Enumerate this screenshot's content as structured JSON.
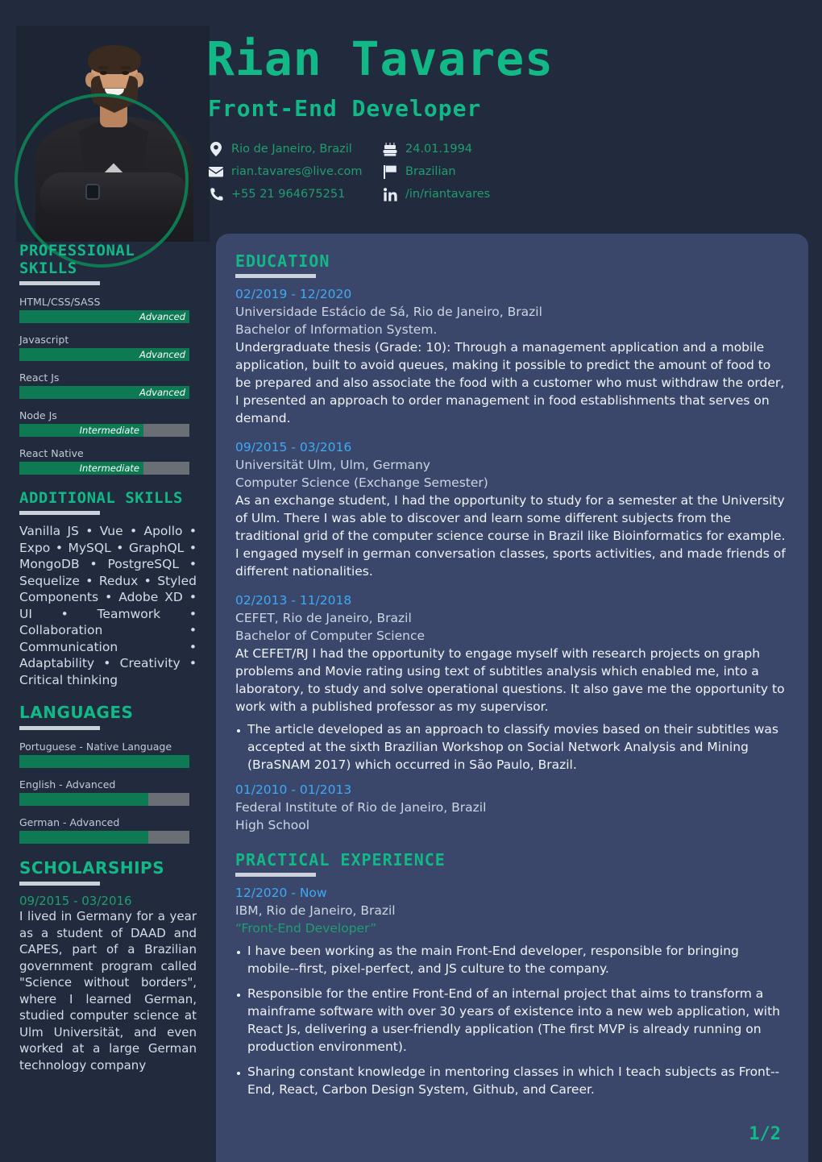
{
  "header": {
    "name": "Rian Tavares",
    "role": "Front-End Developer",
    "contacts": [
      {
        "icon": "location-pin-icon",
        "text": "Rio de Janeiro,  Brazil"
      },
      {
        "icon": "birthday-cake-icon",
        "text": "24.01.1994"
      },
      {
        "icon": "envelope-icon",
        "text": "rian.tavares@live.com"
      },
      {
        "icon": "flag-icon",
        "text": "Brazilian"
      },
      {
        "icon": "phone-icon",
        "text": "+55 21 964675251"
      },
      {
        "icon": "linkedin-icon",
        "text": "/in/riantavares"
      }
    ]
  },
  "sidebar": {
    "professional_skills": {
      "heading": "PROFESSIONAL SKILLS",
      "items": [
        {
          "label": "HTML/CSS/SASS",
          "level": "Advanced",
          "percent": 100
        },
        {
          "label": "Javascript",
          "level": "Advanced",
          "percent": 100
        },
        {
          "label": "React Js",
          "level": "Advanced",
          "percent": 100
        },
        {
          "label": "Node Js",
          "level": "Intermediate",
          "percent": 73
        },
        {
          "label": "React Native",
          "level": "Intermediate",
          "percent": 73
        }
      ]
    },
    "additional_skills": {
      "heading": "ADDITIONAL SKILLS",
      "text": "Vanilla JS • Vue • Apollo • Expo • MySQL • GraphQL • MongoDB • PostgreSQL • Sequelize • Redux • Styled Components • Adobe XD • UI • Teamwork • Collaboration • Communication • Adaptability • Creativity • Critical thinking"
    },
    "languages": {
      "heading": "LANGUAGES",
      "items": [
        {
          "label": "Portuguese - Native Language",
          "percent": 100
        },
        {
          "label": "English - Advanced",
          "percent": 76
        },
        {
          "label": "German - Advanced",
          "percent": 76
        }
      ]
    },
    "scholarships": {
      "heading": "SCHOLARSHIPS",
      "date": "09/2015 - 03/2016",
      "text": "I lived in Germany for a year as a student of DAAD and CAPES, part of a Brazilian government program called \"Science without borders\", where I learned German, studied computer science at Ulm Universität, and even worked at a large German technology company"
    }
  },
  "main": {
    "education": {
      "heading": "EDUCATION",
      "entries": [
        {
          "date": "02/2019 - 12/2020",
          "org": "Universidade Estácio de Sá, Rio de Janeiro, Brazil",
          "degree": "Bachelor of Information System.",
          "body": "Undergraduate thesis (Grade: 10): Through a management application and a mobile application, built to avoid queues, making it possible to predict the amount of food to be prepared and also associate the food with a customer who must withdraw the order, I presented an approach to order management in food establishments that serves on demand."
        },
        {
          "date": "09/2015 - 03/2016",
          "org": "Universität Ulm, Ulm, Germany",
          "degree": "Computer Science (Exchange Semester)",
          "body": "As an exchange student, I had the opportunity to study for a semester at the University of Ulm. There I was able to discover and learn some different subjects from the traditional grid of the computer science course in Brazil like Bioinformatics for example. I engaged myself in german conversation classes, sports activities, and made friends of different nationalities."
        },
        {
          "date": "02/2013 - 11/2018",
          "org": "CEFET, Rio de Janeiro, Brazil",
          "degree": "Bachelor of Computer Science",
          "body": "At CEFET/RJ I had the opportunity to engage myself with research projects on graph problems and Movie rating using text of subtitles analysis which enabled me, into a laboratory, to study and solve operational questions. It also gave me the opportunity to work with a published professor as my supervisor.",
          "bullets": [
            "The article developed as an approach to classify movies based on their subtitles was accepted at the sixth Brazilian Workshop on Social Network Analysis and Mining (BraSNAM 2017) which occurred in São Paulo, Brazil."
          ]
        },
        {
          "date": "01/2010 - 01/2013",
          "org": "Federal Institute of Rio de Janeiro, Brazil",
          "degree": "High School"
        }
      ]
    },
    "practical_experience": {
      "heading": "PRACTICAL EXPERIENCE",
      "entries": [
        {
          "date": "12/2020 - Now",
          "org": "IBM, Rio de Janeiro, Brazil",
          "title": "“Front-End Developer”",
          "bullets": [
            "I have been working as the main Front-End developer, responsible for bringing mobile--first, pixel-perfect, and JS culture to the company.",
            "Responsible for the entire Front-End of an internal project that aims to transform a mainframe software with over 30 years of existence into a new web application, with React Js, delivering a user-friendly application (The first MVP is already running on production environment).",
            "Sharing constant knowledge in mentoring classes in which I teach subjects as Front--End, React, Carbon Design System, Github, and Career."
          ]
        }
      ]
    }
  },
  "page_indicator": "1/2",
  "colors": {
    "background": "#222b3d",
    "card": "#3a476a",
    "accent_green": "#12b886",
    "bar_fill": "#0d7a54",
    "bar_track": "#6a6f76",
    "date_blue": "#3fa9f5",
    "muted_green": "#1f9e6f"
  }
}
